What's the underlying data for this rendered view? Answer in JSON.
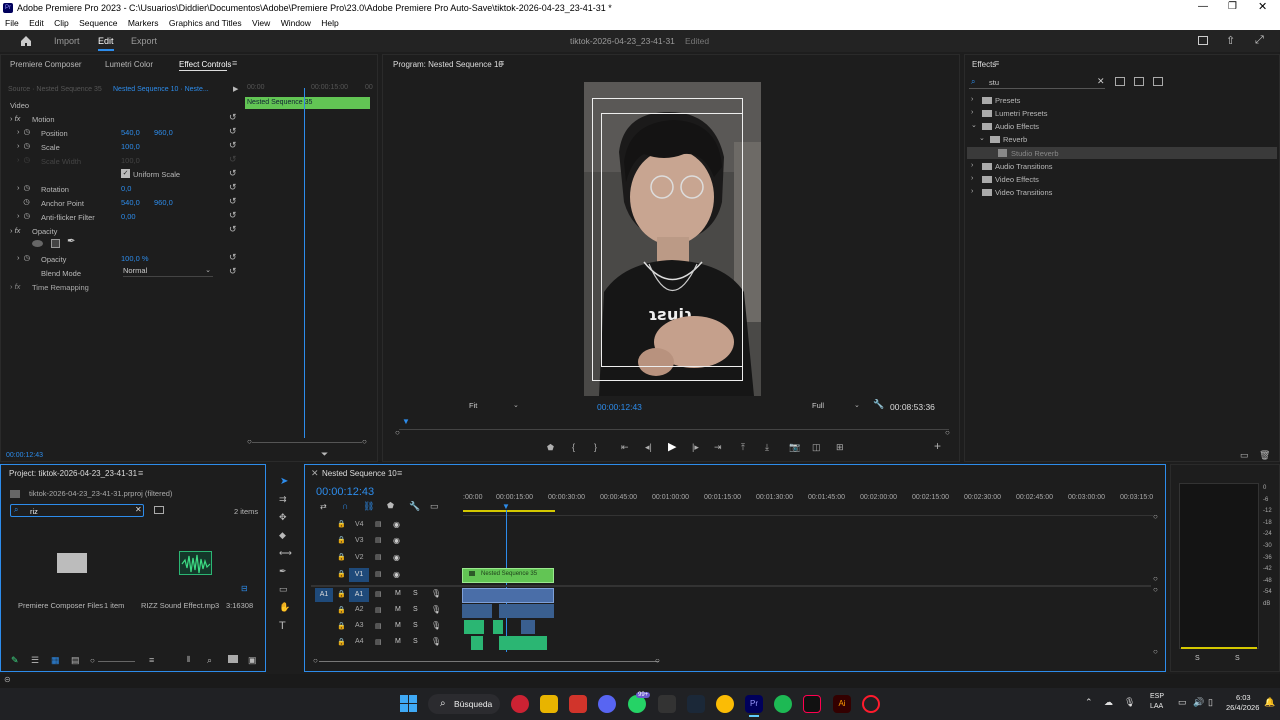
{
  "window": {
    "title": "Adobe Premiere Pro 2023 - C:\\Usuarios\\Diddier\\Documentos\\Adobe\\Premiere Pro\\23.0\\Adobe Premiere Pro Auto-Save\\tiktok-2026-04-23_23-41-31 *"
  },
  "menu": [
    "File",
    "Edit",
    "Clip",
    "Sequence",
    "Markers",
    "Graphics and Titles",
    "View",
    "Window",
    "Help"
  ],
  "workspace": {
    "tabs": [
      "Import",
      "Edit",
      "Export"
    ],
    "active": "Edit",
    "project_name": "tiktok-2026-04-23_23-41-31",
    "status": "Edited"
  },
  "effect_controls": {
    "tabs": [
      "Premiere Composer",
      "Lumetri Color",
      "Effect Controls"
    ],
    "source": "Source · Nested Sequence 35",
    "sequence": "Nested Sequence 10 · Neste...",
    "ruler_start": "00:00",
    "ruler_mid": "00:00:15:00",
    "ruler_end": "00",
    "clip_label": "Nested Sequence 35",
    "section_video": "Video",
    "motion": "Motion",
    "props": [
      {
        "name": "Position",
        "v1": "540,0",
        "v2": "960,0"
      },
      {
        "name": "Scale",
        "v1": "100,0",
        "v2": ""
      },
      {
        "name": "Scale Width",
        "v1": "100,0",
        "v2": ""
      },
      {
        "name": "Uniform Scale",
        "v1": "",
        "v2": ""
      },
      {
        "name": "Rotation",
        "v1": "0,0",
        "v2": ""
      },
      {
        "name": "Anchor Point",
        "v1": "540,0",
        "v2": "960,0"
      },
      {
        "name": "Anti-flicker Filter",
        "v1": "0,00",
        "v2": ""
      }
    ],
    "opacity_section": "Opacity",
    "opacity_label": "Opacity",
    "opacity_value": "100,0 %",
    "blend_label": "Blend Mode",
    "blend_value": "Normal",
    "time_remap": "Time Remapping",
    "timecode": "00:00:12:43"
  },
  "program": {
    "title": "Program: Nested Sequence 10",
    "timecode": "00:00:12:43",
    "fit": "Fit",
    "quality": "Full",
    "duration": "00:08:53:36",
    "shirt_text": "ɿƨuiɿ"
  },
  "effects": {
    "title": "Effects",
    "search": "stu",
    "tree": [
      {
        "label": "Presets",
        "level": 0,
        "expanded": false
      },
      {
        "label": "Lumetri Presets",
        "level": 0,
        "expanded": false
      },
      {
        "label": "Audio Effects",
        "level": 0,
        "expanded": true
      },
      {
        "label": "Reverb",
        "level": 1,
        "expanded": true
      },
      {
        "label": "Studio Reverb",
        "level": 2,
        "selected": true
      },
      {
        "label": "Audio Transitions",
        "level": 0,
        "expanded": false
      },
      {
        "label": "Video Effects",
        "level": 0,
        "expanded": false
      },
      {
        "label": "Video Transitions",
        "level": 0,
        "expanded": false
      }
    ]
  },
  "project": {
    "title": "Project: tiktok-2026-04-23_23-41-31",
    "file": "tiktok-2026-04-23_23-41-31.prproj (filtered)",
    "search": "riz",
    "count": "2 items",
    "items": [
      {
        "name": "Premiere Composer Files",
        "meta": "1 item"
      },
      {
        "name": "RIZZ Sound Effect.mp3",
        "meta": "3:16308"
      }
    ]
  },
  "timeline": {
    "title": "Nested Sequence 10",
    "timecode": "00:00:12:43",
    "ruler": [
      ":00:00",
      "00:00:15:00",
      "00:00:30:00",
      "00:00:45:00",
      "00:01:00:00",
      "00:01:15:00",
      "00:01:30:00",
      "00:01:45:00",
      "00:02:00:00",
      "00:02:15:00",
      "00:02:30:00",
      "00:02:45:00",
      "00:03:00:00",
      "00:03:15:0"
    ],
    "video_tracks": [
      "V4",
      "V3",
      "V2",
      "V1"
    ],
    "audio_tracks": [
      "A1",
      "A2",
      "A3",
      "A4"
    ],
    "clip_label": "Nested Sequence 35",
    "m": "M",
    "s": "S"
  },
  "meter": {
    "scale": [
      "0",
      "-6",
      "-12",
      "-18",
      "-24",
      "-30",
      "-36",
      "-42",
      "-48",
      "-54",
      "dB"
    ],
    "s": "S"
  },
  "taskbar": {
    "search": "Búsqueda",
    "lang1": "ESP",
    "lang2": "LAA",
    "time": "6:03",
    "date": "26/4/2026",
    "badge": "99+"
  },
  "colors": {
    "accent": "#2d8ceb",
    "clip_green": "#62c554",
    "panel": "#1d1d1d",
    "bg": "#141414"
  }
}
